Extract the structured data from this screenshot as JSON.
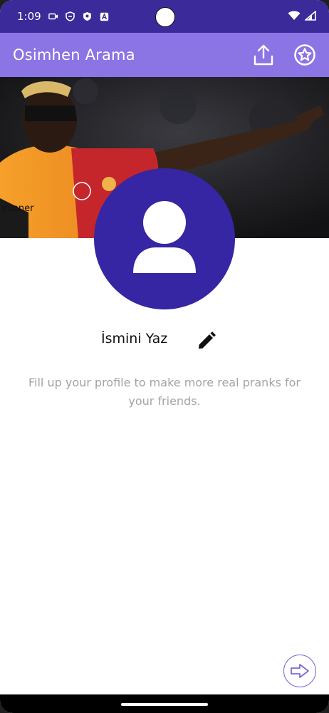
{
  "status_bar": {
    "time": "1:09",
    "icons_left": [
      "video-icon",
      "shield-icon",
      "security-badge-icon",
      "a-icon"
    ],
    "icons_right": [
      "wifi-icon",
      "signal-icon"
    ]
  },
  "app_bar": {
    "title": "Osimhen Arama",
    "actions": [
      "share-icon",
      "star-badge-icon"
    ],
    "background": "#8b74e3"
  },
  "banner": {
    "description_icon": "player-photo",
    "jersey_text": "yuoner"
  },
  "profile": {
    "avatar_icon": "person-icon",
    "avatar_color": "#3626a3",
    "name_placeholder": "İsmini Yaz",
    "edit_icon": "pencil-icon",
    "hint": "Fill up your profile to make more real pranks for your friends."
  },
  "next_button": {
    "icon": "arrow-right-icon"
  }
}
